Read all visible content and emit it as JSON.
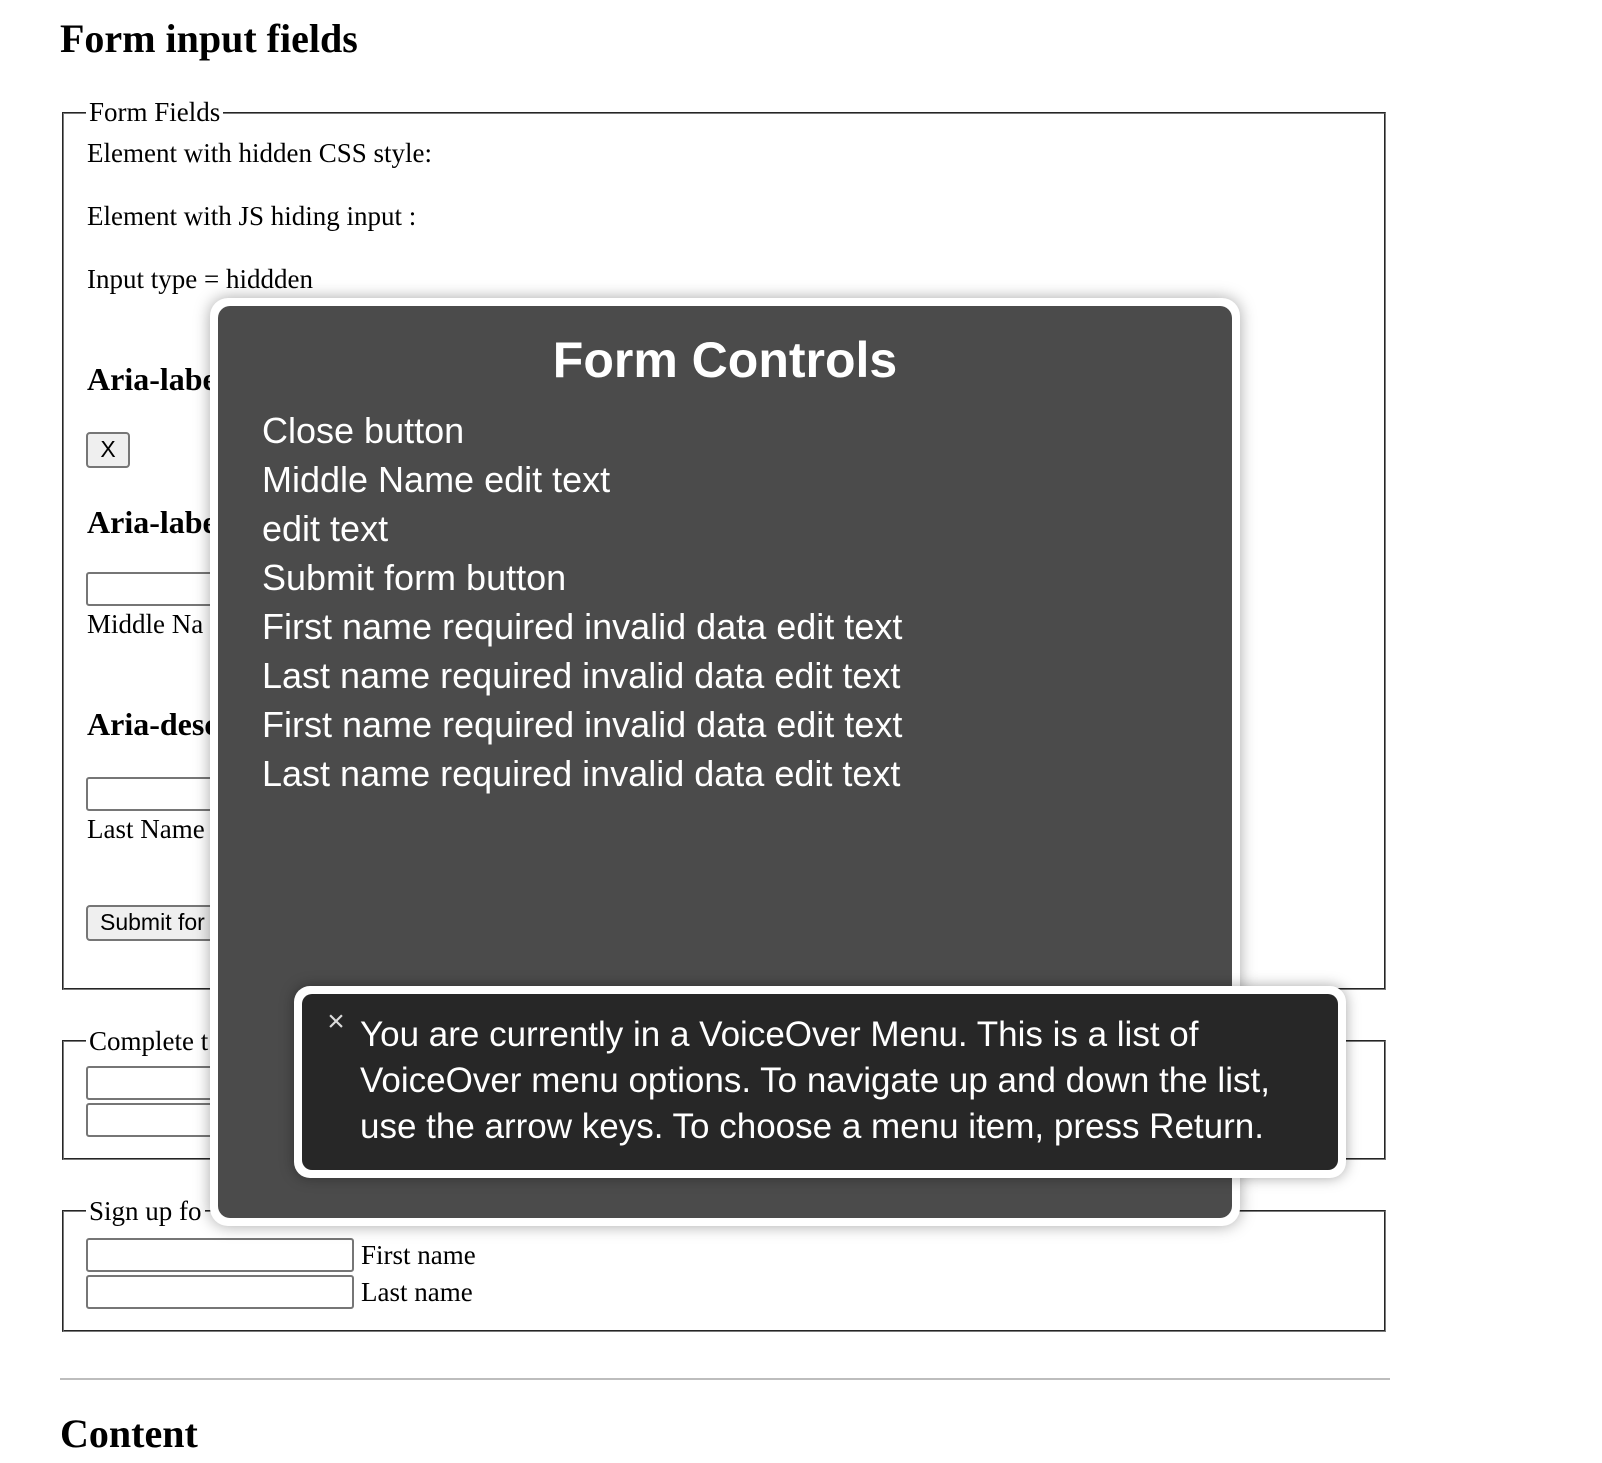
{
  "page": {
    "title": "Form input fields",
    "next_heading": "Content"
  },
  "form_fields": {
    "legend": "Form Fields",
    "hidden_css_label": "Element with hidden CSS style:",
    "js_hiding_label": "Element with JS hiding input :",
    "input_hidden_label": "Input type = hiddden",
    "aria_label_heading_1": "Aria-labe",
    "close_button": "X",
    "aria_label_heading_2": "Aria-labe",
    "middle_name_label": "Middle Na",
    "aria_desc_heading": "Aria-desc",
    "last_name_label": "Last Name",
    "submit_button": "Submit for"
  },
  "complete_section": {
    "legend": "Complete t"
  },
  "signup_section": {
    "legend": "Sign up fo",
    "first_name_label": "First name",
    "last_name_label": "Last name"
  },
  "voiceover_menu": {
    "title": "Form Controls",
    "items": [
      "Close button",
      "Middle Name edit text",
      "edit text",
      "Submit form button",
      "First name required invalid data edit text",
      "Last name required invalid data edit text",
      "First name required invalid data edit text",
      "Last name required invalid data edit text"
    ]
  },
  "voiceover_hint": {
    "close_icon": "×",
    "text": "You are currently in a VoiceOver Menu. This is a list of VoiceOver menu options. To navigate up and down the list, use the arrow keys. To choose a menu item, press Return."
  }
}
